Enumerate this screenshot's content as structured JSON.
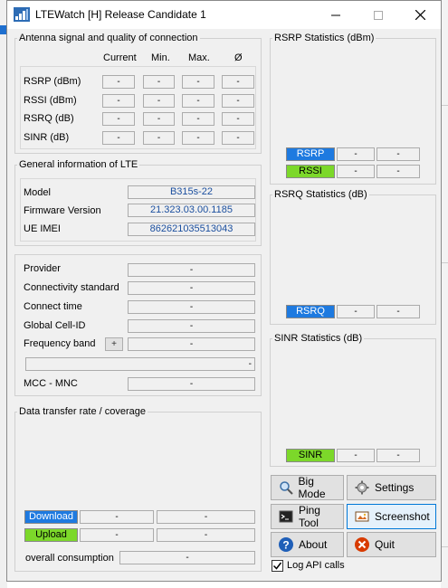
{
  "window": {
    "title": "LTEWatch [H]  Release Candidate 1"
  },
  "antenna": {
    "group_title": "Antenna signal and quality of connection",
    "columns": [
      "Current",
      "Min.",
      "Max.",
      "Ø"
    ],
    "rows": [
      {
        "label": "RSRP (dBm)",
        "values": [
          "-",
          "-",
          "-",
          "-"
        ]
      },
      {
        "label": "RSSI (dBm)",
        "values": [
          "-",
          "-",
          "-",
          "-"
        ]
      },
      {
        "label": "RSRQ (dB)",
        "values": [
          "-",
          "-",
          "-",
          "-"
        ]
      },
      {
        "label": "SINR (dB)",
        "values": [
          "-",
          "-",
          "-",
          "-"
        ]
      }
    ]
  },
  "lte_info": {
    "group_title": "General information of LTE",
    "model_label": "Model",
    "model_value": "B315s-22",
    "firmware_label": "Firmware Version",
    "firmware_value": "21.323.03.00.1185",
    "imei_label": "UE IMEI",
    "imei_value": "862621035513043"
  },
  "provider": {
    "provider_label": "Provider",
    "provider_value": "-",
    "conn_standard_label": "Connectivity standard",
    "conn_standard_value": "-",
    "connect_time_label": "Connect time",
    "connect_time_value": "-",
    "cell_id_label": "Global Cell-ID",
    "cell_id_value": "-",
    "freq_band_label": "Frequency band",
    "freq_band_button": "+",
    "freq_band_value": "-",
    "extra_value": "-",
    "mcc_mnc_label": "MCC - MNC",
    "mcc_mnc_value": "-"
  },
  "transfer": {
    "group_title": "Data transfer rate / coverage",
    "download_label": "Download",
    "download_values": [
      "-",
      "-"
    ],
    "upload_label": "Upload",
    "upload_values": [
      "-",
      "-"
    ],
    "overall_label": "overall consumption",
    "overall_value": "-"
  },
  "rsrp_stats": {
    "group_title": "RSRP Statistics (dBm)",
    "series": [
      {
        "name": "RSRP",
        "color": "#1e7ae0",
        "values": [
          "-",
          "-"
        ]
      },
      {
        "name": "RSSI",
        "color": "#7cd82a",
        "values": [
          "-",
          "-"
        ]
      }
    ]
  },
  "rsrq_stats": {
    "group_title": "RSRQ Statistics (dB)",
    "series": [
      {
        "name": "RSRQ",
        "color": "#1e7ae0",
        "values": [
          "-",
          "-"
        ]
      }
    ]
  },
  "sinr_stats": {
    "group_title": "SINR Statistics (dB)",
    "series": [
      {
        "name": "SINR",
        "color": "#7cd82a",
        "values": [
          "-",
          "-"
        ]
      }
    ]
  },
  "buttons": {
    "big_mode": "Big Mode",
    "settings": "Settings",
    "ping_tool": "Ping Tool",
    "screenshot": "Screenshot",
    "about": "About",
    "quit": "Quit"
  },
  "log_api": {
    "label": "Log API calls",
    "checked": true
  },
  "colors": {
    "download": "#1e7ae0",
    "upload": "#7cd82a",
    "focus_border": "#0078d7",
    "quit_red": "#d83b01"
  }
}
